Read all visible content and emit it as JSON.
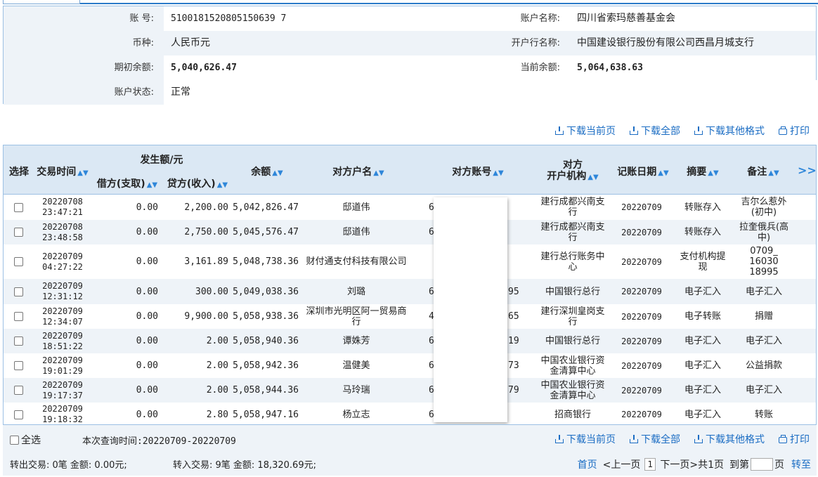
{
  "account": {
    "acct_no_label": "账    号:",
    "acct_no": "5100181520805150639 7",
    "acct_name_label": "账户名称:",
    "acct_name": "四川省索玛慈善基金会",
    "currency_label": "币种:",
    "currency": "人民币元",
    "bank_label": "开户行名称:",
    "bank": "中国建设银行股份有限公司西昌月城支行",
    "opening_label": "期初余额:",
    "opening": "5,040,626.47",
    "current_label": "当前余额:",
    "current": "5,064,638.63",
    "status_label": "账户状态:",
    "status": "正常"
  },
  "actions": {
    "download_page": "下载当前页",
    "download_all": "下载全部",
    "download_other": "下载其他格式",
    "print": "打印"
  },
  "table": {
    "headers": {
      "select": "选择",
      "time": "交易时间",
      "amount_group": "发生额/元",
      "debit": "借方(支取)",
      "credit": "贷方(收入)",
      "balance": "余额",
      "cp_name": "对方户名",
      "cp_acct": "对方账号",
      "cp_bank_1": "对方",
      "cp_bank_2": "开户机构",
      "post_date": "记账日期",
      "summary": "摘要",
      "remark": "备注",
      "more": ">>"
    },
    "rows": [
      {
        "d": "20220708",
        "t": "23:47:21",
        "debit": "0.00",
        "credit": "2,200.00",
        "balance": "5,042,826.47",
        "name": "邸道伟",
        "acct_l": "6",
        "acct_r": "",
        "bank": "建行成都兴南支行",
        "post": "20220709",
        "summary": "转账存入",
        "remark": "吉尔么惹外(初中)"
      },
      {
        "d": "20220708",
        "t": "23:48:58",
        "debit": "0.00",
        "credit": "2,750.00",
        "balance": "5,045,576.47",
        "name": "邸道伟",
        "acct_l": "6",
        "acct_r": "",
        "bank": "建行成都兴南支行",
        "post": "20220709",
        "summary": "转账存入",
        "remark": "拉奎俄兵(高中)"
      },
      {
        "d": "20220709",
        "t": "04:27:22",
        "debit": "0.00",
        "credit": "3,161.89",
        "balance": "5,048,738.36",
        "name": "财付通支付科技有限公司",
        "acct_l": "",
        "acct_r": "",
        "bank": "建行总行账务中心",
        "post": "20220709",
        "summary": "支付机构提现",
        "remark": "0709_ 16030 18995"
      },
      {
        "d": "20220709",
        "t": "12:31:12",
        "debit": "0.00",
        "credit": "300.00",
        "balance": "5,049,038.36",
        "name": "刘璐",
        "acct_l": "601",
        "acct_r": "95",
        "bank": "中国银行总行",
        "post": "20220709",
        "summary": "电子汇入",
        "remark": "电子汇入"
      },
      {
        "d": "20220709",
        "t": "12:34:07",
        "debit": "0.00",
        "credit": "9,900.00",
        "balance": "5,058,938.36",
        "name": "深圳市光明区阿一贸易商行",
        "acct_l": "442",
        "acct_r": "65",
        "bank": "建行深圳皇岗支行",
        "post": "20220709",
        "summary": "电子转账",
        "remark": "捐赠"
      },
      {
        "d": "20220709",
        "t": "18:51:22",
        "debit": "0.00",
        "credit": "2.00",
        "balance": "5,058,940.36",
        "name": "谭姝芳",
        "acct_l": "621",
        "acct_r": "19",
        "bank": "中国银行总行",
        "post": "20220709",
        "summary": "电子汇入",
        "remark": "电子汇入"
      },
      {
        "d": "20220709",
        "t": "19:01:29",
        "debit": "0.00",
        "credit": "2.00",
        "balance": "5,058,942.36",
        "name": "温健美",
        "acct_l": "622",
        "acct_r": "73",
        "bank": "中国农业银行资金清算中心",
        "post": "20220709",
        "summary": "电子汇入",
        "remark": "公益捐款"
      },
      {
        "d": "20220709",
        "t": "19:17:37",
        "debit": "0.00",
        "credit": "2.00",
        "balance": "5,058,944.36",
        "name": "马玲瑞",
        "acct_l": "623",
        "acct_r": "79",
        "bank": "中国农业银行资金清算中心",
        "post": "20220709",
        "summary": "电子汇入",
        "remark": "电子汇入"
      },
      {
        "d": "20220709",
        "t": "19:18:32",
        "debit": "0.00",
        "credit": "2.80",
        "balance": "5,058,947.16",
        "name": "杨立志",
        "acct_l": "6",
        "acct_r": "",
        "bank": "招商银行",
        "post": "20220709",
        "summary": "电子汇入",
        "remark": "转账"
      }
    ]
  },
  "footer": {
    "select_all": "全选",
    "query_time": "本次查询时间:20220709-20220709",
    "out_summary": "转出交易: 0笔    金额: 0.00元;",
    "in_summary": "转入交易: 9笔    金额: 18,320.69元;",
    "first": "首页",
    "prev": "<上一页",
    "page": "1",
    "next": "下一页>",
    "total": "共1页",
    "goto": "到第",
    "page_unit": "页",
    "go": "转至"
  }
}
